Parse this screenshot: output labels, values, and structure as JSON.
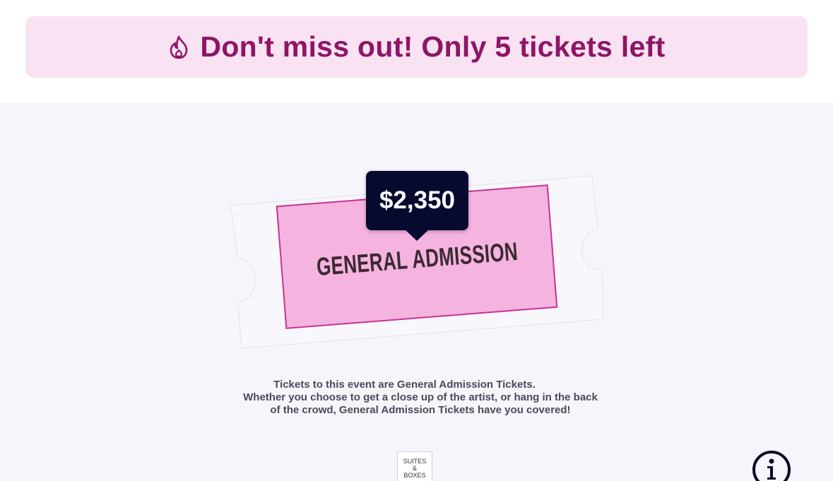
{
  "banner": {
    "icon": "flame-icon",
    "text": "Don't miss out! Only 5 tickets left",
    "text_color": "#8e1566",
    "background": "#f9e2f1"
  },
  "ticket": {
    "label": "General Admission",
    "price": "$2,350",
    "fill_color": "#f5b3e0",
    "border_color": "#c83495"
  },
  "description": {
    "line1": "Tickets to this event are General Admission Tickets.",
    "line2": "Whether you choose to get a close up of the artist, or hang in the back of the crowd, General Admission Tickets have you covered!"
  },
  "suites_box": {
    "line1": "SUITES",
    "line2": "&",
    "line3": "BOXES"
  },
  "info_button": {
    "icon": "info-icon"
  }
}
